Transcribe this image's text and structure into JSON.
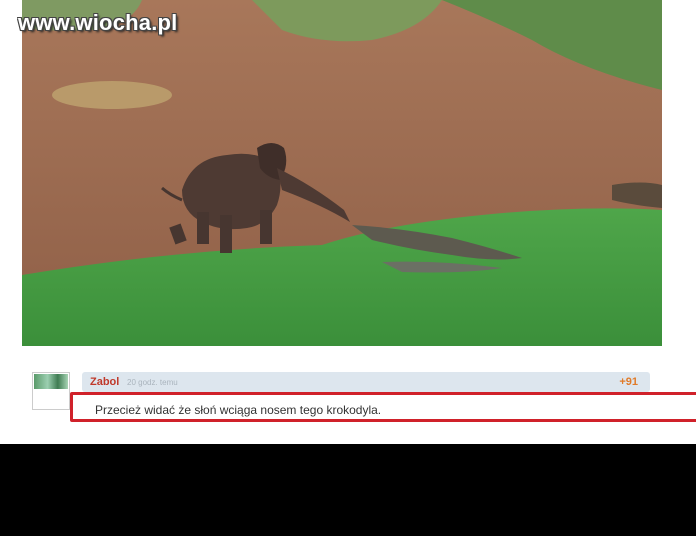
{
  "watermark": "www.wiocha.pl",
  "photo": {
    "subject": "baby-elephant-pulling-crocodile"
  },
  "comment": {
    "author": "Zabol",
    "time": "20 godz. temu",
    "score": "+91",
    "text": "Przecież widać że słoń wciąga nosem tego krokodyla."
  },
  "colors": {
    "highlight_border": "#d0212a",
    "author": "#c0392b",
    "score": "#e07b2a",
    "meta_bar": "#dde6ee"
  }
}
